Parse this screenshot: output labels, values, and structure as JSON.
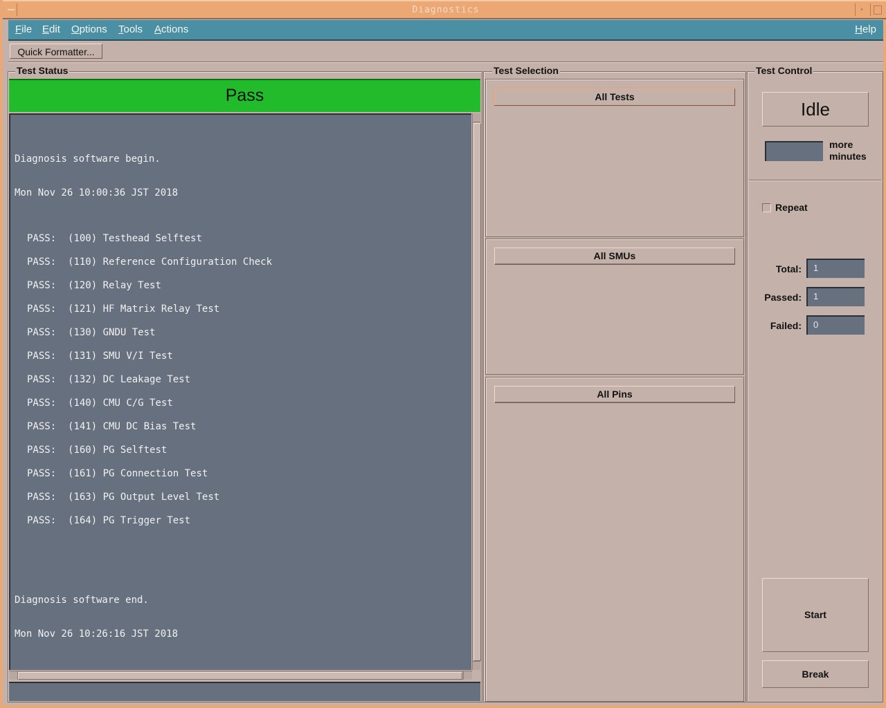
{
  "window": {
    "title": "Diagnostics"
  },
  "menubar": {
    "items": [
      {
        "label": "File",
        "mnemonic": "F",
        "rest": "ile"
      },
      {
        "label": "Edit",
        "mnemonic": "E",
        "rest": "dit"
      },
      {
        "label": "Options",
        "mnemonic": "O",
        "rest": "ptions"
      },
      {
        "label": "Tools",
        "mnemonic": "T",
        "rest": "ools"
      },
      {
        "label": "Actions",
        "mnemonic": "A",
        "rest": "ctions"
      }
    ],
    "help": {
      "label": "Help",
      "mnemonic": "H",
      "rest": "elp"
    }
  },
  "toolbar": {
    "quick_formatter_label": "Quick Formatter..."
  },
  "test_status": {
    "title": "Test Status",
    "result": "Pass",
    "result_color": "#22bb2b",
    "log": {
      "begin_msg": "Diagnosis software begin.",
      "begin_time": "Mon Nov 26 10:00:36 JST 2018",
      "entries": [
        {
          "status": "PASS:",
          "code": "(100)",
          "name": "Testhead Selftest"
        },
        {
          "status": "PASS:",
          "code": "(110)",
          "name": "Reference Configuration Check"
        },
        {
          "status": "PASS:",
          "code": "(120)",
          "name": "Relay Test"
        },
        {
          "status": "PASS:",
          "code": "(121)",
          "name": "HF Matrix Relay Test"
        },
        {
          "status": "PASS:",
          "code": "(130)",
          "name": "GNDU Test"
        },
        {
          "status": "PASS:",
          "code": "(131)",
          "name": "SMU V/I Test"
        },
        {
          "status": "PASS:",
          "code": "(132)",
          "name": "DC Leakage Test"
        },
        {
          "status": "PASS:",
          "code": "(140)",
          "name": "CMU C/G Test"
        },
        {
          "status": "PASS:",
          "code": "(141)",
          "name": "CMU DC Bias Test"
        },
        {
          "status": "PASS:",
          "code": "(160)",
          "name": "PG Selftest"
        },
        {
          "status": "PASS:",
          "code": "(161)",
          "name": "PG Connection Test"
        },
        {
          "status": "PASS:",
          "code": "(163)",
          "name": "PG Output Level Test"
        },
        {
          "status": "PASS:",
          "code": "(164)",
          "name": "PG Trigger Test"
        }
      ],
      "end_msg": "Diagnosis software end.",
      "end_time": "Mon Nov 26 10:26:16 JST 2018"
    },
    "status_field_value": ""
  },
  "test_selection": {
    "title": "Test Selection",
    "buttons": [
      "All Tests",
      "All SMUs",
      "All Pins"
    ]
  },
  "test_control": {
    "title": "Test Control",
    "state": "Idle",
    "more_minutes_value": "",
    "more_minutes_label_1": "more",
    "more_minutes_label_2": "minutes",
    "repeat_label": "Repeat",
    "repeat_checked": false,
    "total_label": "Total:",
    "total_value": "1",
    "passed_label": "Passed:",
    "passed_value": "1",
    "failed_label": "Failed:",
    "failed_value": "0",
    "start_label": "Start",
    "break_label": "Break"
  }
}
